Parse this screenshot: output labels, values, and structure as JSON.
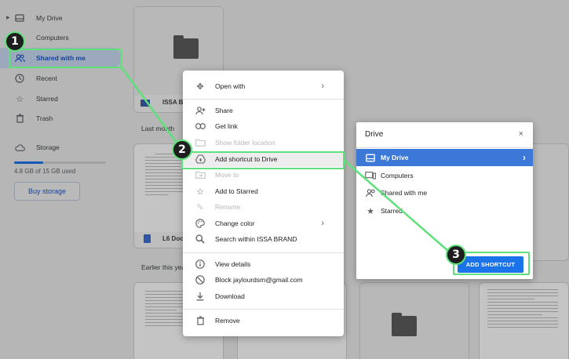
{
  "sidebar": {
    "items": [
      {
        "label": "My Drive",
        "icon": "drive-icon"
      },
      {
        "label": "Computers",
        "icon": "computer-icon"
      },
      {
        "label": "Shared with me",
        "icon": "people-icon",
        "active": true
      },
      {
        "label": "Recent",
        "icon": "clock-icon"
      },
      {
        "label": "Starred",
        "icon": "star-icon"
      },
      {
        "label": "Trash",
        "icon": "trash-icon"
      }
    ],
    "storage_label": "Storage",
    "storage_usage": "4.8 GB of 15 GB used",
    "storage_fraction": 0.32,
    "buy_label": "Buy storage"
  },
  "main": {
    "sections": [
      "Last month",
      "Earlier this year"
    ],
    "folder_card_title": "ISSA B",
    "doc_card_title": "L6 Doc"
  },
  "context_menu": {
    "items": [
      {
        "label": "Open with",
        "icon": "open-with-icon",
        "submenu": true
      },
      {
        "label": "Share",
        "icon": "share-person-icon"
      },
      {
        "label": "Get link",
        "icon": "link-icon"
      },
      {
        "label": "Show folder location",
        "icon": "folder-icon",
        "disabled": true
      },
      {
        "label": "Add shortcut to Drive",
        "icon": "add-shortcut-icon",
        "highlighted": true
      },
      {
        "label": "Move to",
        "icon": "move-to-icon",
        "disabled": true
      },
      {
        "label": "Add to Starred",
        "icon": "star-icon"
      },
      {
        "label": "Rename",
        "icon": "pencil-icon",
        "disabled": true
      },
      {
        "label": "Change color",
        "icon": "palette-icon",
        "submenu": true
      },
      {
        "label": "Search within ISSA BRAND",
        "icon": "search-icon"
      },
      {
        "label": "View details",
        "icon": "info-icon"
      },
      {
        "label": "Block jaylourdsm@gmail.com",
        "icon": "block-icon"
      },
      {
        "label": "Download",
        "icon": "download-icon"
      },
      {
        "label": "Remove",
        "icon": "trash-icon"
      }
    ]
  },
  "dialog": {
    "title": "Drive",
    "close": "×",
    "items": [
      {
        "label": "My Drive",
        "icon": "drive-icon",
        "selected": true
      },
      {
        "label": "Computers",
        "icon": "computer-icon"
      },
      {
        "label": "Shared with me",
        "icon": "people-icon"
      },
      {
        "label": "Starred",
        "icon": "star-icon"
      }
    ],
    "button": "ADD SHORTCUT"
  },
  "annotations": {
    "steps": [
      "1",
      "2",
      "3"
    ],
    "color": "#5ee07b"
  },
  "colors": {
    "accent": "#1a73e8",
    "selected_row": "#3c78d8"
  }
}
